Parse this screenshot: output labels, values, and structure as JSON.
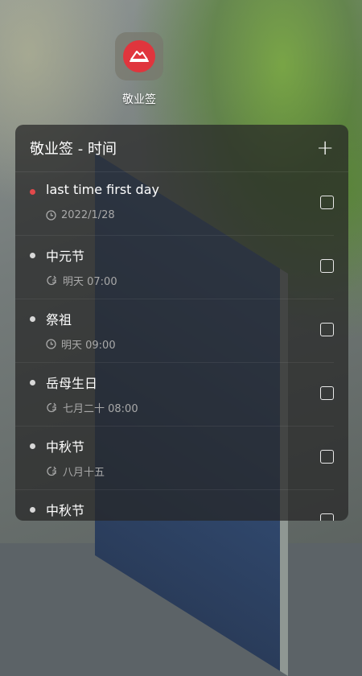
{
  "app": {
    "label": "敬业签"
  },
  "widget": {
    "title": "敬业签 - 时间",
    "items": [
      {
        "title": "last time first day",
        "meta": "2022/1/28",
        "icon": "clock-icon",
        "dot": "red"
      },
      {
        "title": "中元节",
        "meta": "明天 07:00",
        "icon": "lunar-repeat-icon",
        "dot": "gray"
      },
      {
        "title": "祭祖",
        "meta": "明天 09:00",
        "icon": "clock-icon",
        "dot": "gray"
      },
      {
        "title": "岳母生日",
        "meta": "七月二十 08:00",
        "icon": "lunar-repeat-icon",
        "dot": "gray"
      },
      {
        "title": "中秋节",
        "meta": "八月十五",
        "icon": "lunar-repeat-icon",
        "dot": "gray"
      },
      {
        "title": "中秋节",
        "meta": "",
        "icon": "",
        "dot": "gray"
      }
    ]
  },
  "colors": {
    "accent_red": "#e2494b",
    "widget_bg": "#262626"
  }
}
